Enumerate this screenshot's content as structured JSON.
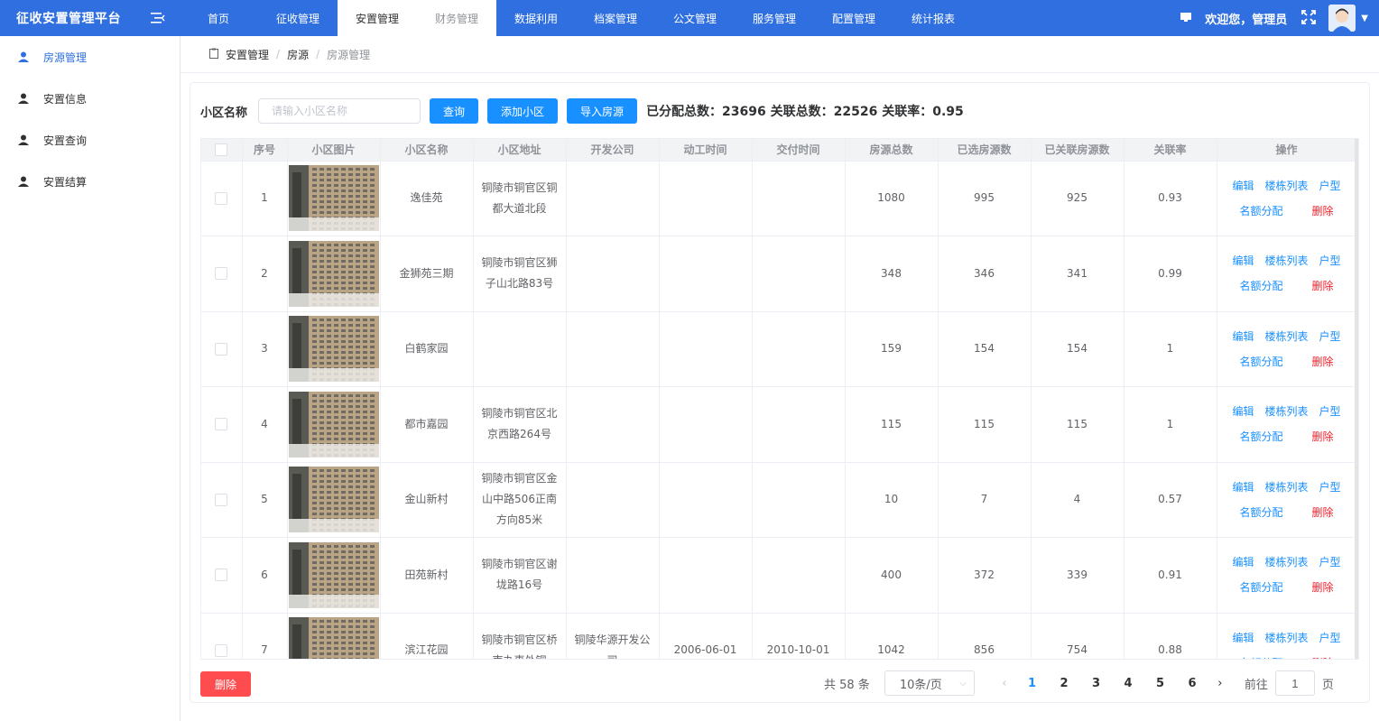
{
  "app": {
    "title": "征收安置管理平台"
  },
  "nav": [
    {
      "label": "首页",
      "state": ""
    },
    {
      "label": "征收管理",
      "state": ""
    },
    {
      "label": "安置管理",
      "state": "active"
    },
    {
      "label": "财务管理",
      "state": "light"
    },
    {
      "label": "数据利用",
      "state": ""
    },
    {
      "label": "档案管理",
      "state": ""
    },
    {
      "label": "公文管理",
      "state": ""
    },
    {
      "label": "服务管理",
      "state": ""
    },
    {
      "label": "配置管理",
      "state": ""
    },
    {
      "label": "统计报表",
      "state": ""
    }
  ],
  "header": {
    "welcome": "欢迎您，管理员"
  },
  "sidebar": {
    "items": [
      {
        "label": "房源管理",
        "active": true
      },
      {
        "label": "安置信息",
        "active": false
      },
      {
        "label": "安置查询",
        "active": false
      },
      {
        "label": "安置结算",
        "active": false
      }
    ]
  },
  "breadcrumb": {
    "items": [
      "安置管理",
      "房源"
    ],
    "current": "房源管理"
  },
  "search": {
    "label": "小区名称",
    "placeholder": "请输入小区名称",
    "query_btn": "查询",
    "add_btn": "添加小区",
    "import_btn": "导入房源"
  },
  "stats": {
    "text": "已分配总数：23696 关联总数：22526 关联率：0.95"
  },
  "table": {
    "columns": [
      "序号",
      "小区图片",
      "小区名称",
      "小区地址",
      "开发公司",
      "动工时间",
      "交付时间",
      "房源总数",
      "已选房源数",
      "已关联房源数",
      "关联率",
      "操作"
    ],
    "rows": [
      {
        "no": "1",
        "name": "逸佳苑",
        "address": "铜陵市铜官区铜都大道北段",
        "developer": "",
        "start": "",
        "delivery": "",
        "total": "1080",
        "selected": "995",
        "linked": "925",
        "rate": "0.93"
      },
      {
        "no": "2",
        "name": "金狮苑三期",
        "address": "铜陵市铜官区狮子山北路83号",
        "developer": "",
        "start": "",
        "delivery": "",
        "total": "348",
        "selected": "346",
        "linked": "341",
        "rate": "0.99"
      },
      {
        "no": "3",
        "name": "白鹤家园",
        "address": "",
        "developer": "",
        "start": "",
        "delivery": "",
        "total": "159",
        "selected": "154",
        "linked": "154",
        "rate": "1"
      },
      {
        "no": "4",
        "name": "都市嘉园",
        "address": "铜陵市铜官区北京西路264号",
        "developer": "",
        "start": "",
        "delivery": "",
        "total": "115",
        "selected": "115",
        "linked": "115",
        "rate": "1"
      },
      {
        "no": "5",
        "name": "金山新村",
        "address": "铜陵市铜官区金山中路506正南方向85米",
        "developer": "",
        "start": "",
        "delivery": "",
        "total": "10",
        "selected": "7",
        "linked": "4",
        "rate": "0.57"
      },
      {
        "no": "6",
        "name": "田苑新村",
        "address": "铜陵市铜官区谢垅路16号",
        "developer": "",
        "start": "",
        "delivery": "",
        "total": "400",
        "selected": "372",
        "linked": "339",
        "rate": "0.91"
      },
      {
        "no": "7",
        "name": "滨江花园",
        "address": "铜陵市铜官区桥南办事处铜",
        "developer": "铜陵华源开发公司",
        "start": "2006-06-01",
        "delivery": "2010-10-01",
        "total": "1042",
        "selected": "856",
        "linked": "754",
        "rate": "0.88"
      }
    ],
    "ops": {
      "edit": "编辑",
      "building": "楼栋列表",
      "type": "户型",
      "quota": "名额分配",
      "delete": "删除"
    }
  },
  "footer": {
    "delete_btn": "删除",
    "total": "共 58 条",
    "page_size": "10条/页",
    "pages": [
      "1",
      "2",
      "3",
      "4",
      "5",
      "6"
    ],
    "current_page": "1",
    "goto_label": "前往",
    "goto_value": "1",
    "page_suffix": "页"
  },
  "colors": {
    "primary": "#2f6fe0",
    "button": "#1890ff",
    "danger": "#ff4d4f"
  }
}
